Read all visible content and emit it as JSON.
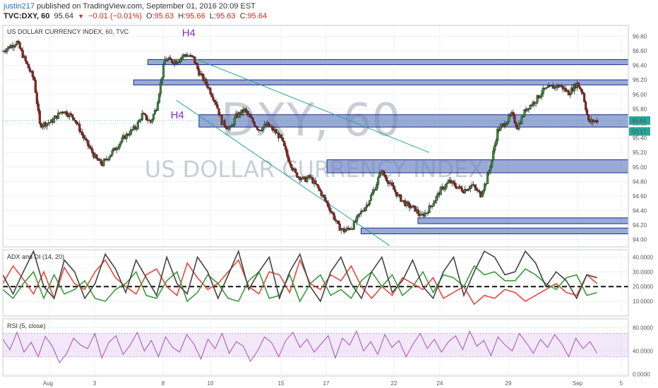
{
  "header": {
    "user": "justin217",
    "published": "published on TradingView.com, September 01, 2016 20:09 EST",
    "symbol": "TVC:DXY, 60",
    "price": "95.64",
    "change": "−0.01 (−0.01%)",
    "o_label": "O:",
    "o_value": "95.63",
    "h_label": "H:",
    "h_value": "95.66",
    "l_label": "L:",
    "l_value": "95.63",
    "c_label": "C:",
    "c_value": "95.64"
  },
  "chart_data": [
    {
      "type": "candlestick",
      "title": "US DOLLAR CURRENCY INDEX, 60, TVC",
      "watermark_symbol": "DXY, 60",
      "watermark_name": "US DOLLAR CURRENCY INDEX",
      "ylim": [
        93.9,
        96.95
      ],
      "y_ticks": [
        94.0,
        94.2,
        94.4,
        94.6,
        94.8,
        95.0,
        95.2,
        95.4,
        95.6,
        95.8,
        96.0,
        96.2,
        96.4,
        96.6,
        96.8
      ],
      "y_tick_labels": [
        "94.00",
        "94.20",
        "94.40",
        "94.60",
        "94.80",
        "95.00",
        "95.20",
        "95.40",
        "95.60",
        "95.80",
        "96.00",
        "96.20",
        "96.40",
        "96.60",
        "96.80"
      ],
      "x_ticks": [
        "Aug",
        "3",
        "8",
        "10",
        "15",
        "17",
        "22",
        "24",
        "29",
        "Sep",
        "5"
      ],
      "price_marker": {
        "value": 95.64,
        "label": "95.64",
        "color": "#26a69a"
      },
      "countdown_marker": {
        "value": 95.49,
        "label": "50:17",
        "color": "#26a69a"
      },
      "price_path": [
        [
          0,
          96.6
        ],
        [
          5,
          96.72
        ],
        [
          8,
          96.45
        ],
        [
          11,
          96.2
        ],
        [
          13,
          95.58
        ],
        [
          17,
          95.62
        ],
        [
          21,
          95.78
        ],
        [
          25,
          95.68
        ],
        [
          29,
          95.36
        ],
        [
          33,
          95.1
        ],
        [
          35,
          95.04
        ],
        [
          39,
          95.23
        ],
        [
          43,
          95.42
        ],
        [
          47,
          95.56
        ],
        [
          49,
          95.72
        ],
        [
          52,
          95.62
        ],
        [
          54,
          95.82
        ],
        [
          57,
          96.48
        ],
        [
          61,
          96.45
        ],
        [
          64,
          96.55
        ],
        [
          67,
          96.5
        ],
        [
          69,
          96.3
        ],
        [
          72,
          96.12
        ],
        [
          75,
          95.88
        ],
        [
          77,
          95.62
        ],
        [
          80,
          95.52
        ],
        [
          82,
          95.7
        ],
        [
          85,
          95.78
        ],
        [
          88,
          95.62
        ],
        [
          90,
          95.52
        ],
        [
          93,
          95.58
        ],
        [
          96,
          95.48
        ],
        [
          98,
          95.38
        ],
        [
          100,
          95.15
        ],
        [
          103,
          94.9
        ],
        [
          106,
          94.82
        ],
        [
          108,
          94.86
        ],
        [
          111,
          94.7
        ],
        [
          114,
          94.5
        ],
        [
          116,
          94.35
        ],
        [
          118,
          94.18
        ],
        [
          120,
          94.12
        ],
        [
          123,
          94.18
        ],
        [
          126,
          94.38
        ],
        [
          128,
          94.48
        ],
        [
          131,
          94.72
        ],
        [
          133,
          94.95
        ],
        [
          136,
          94.78
        ],
        [
          139,
          94.6
        ],
        [
          142,
          94.48
        ],
        [
          145,
          94.42
        ],
        [
          147,
          94.32
        ],
        [
          149,
          94.38
        ],
        [
          152,
          94.55
        ],
        [
          154,
          94.68
        ],
        [
          157,
          94.8
        ],
        [
          160,
          94.72
        ],
        [
          162,
          94.68
        ],
        [
          165,
          94.75
        ],
        [
          168,
          94.62
        ],
        [
          170,
          94.8
        ],
        [
          172,
          95.1
        ],
        [
          174,
          95.5
        ],
        [
          176,
          95.58
        ],
        [
          179,
          95.72
        ],
        [
          181,
          95.55
        ],
        [
          184,
          95.8
        ],
        [
          187,
          95.9
        ],
        [
          190,
          96.05
        ],
        [
          193,
          96.1
        ],
        [
          196,
          96.12
        ],
        [
          199,
          96.02
        ],
        [
          202,
          96.15
        ],
        [
          204,
          96.02
        ],
        [
          206,
          95.62
        ],
        [
          209,
          95.64
        ]
      ],
      "zones": [
        {
          "from_x": 51,
          "to_x": 220,
          "y_low": 96.41,
          "y_high": 96.48
        },
        {
          "from_x": 46,
          "to_x": 220,
          "y_low": 96.13,
          "y_high": 96.2
        },
        {
          "from_x": 69,
          "to_x": 220,
          "y_low": 95.55,
          "y_high": 95.72
        },
        {
          "from_x": 114,
          "to_x": 220,
          "y_low": 94.92,
          "y_high": 95.1
        },
        {
          "from_x": 146,
          "to_x": 220,
          "y_low": 94.22,
          "y_high": 94.3
        },
        {
          "from_x": 126,
          "to_x": 220,
          "y_low": 94.08,
          "y_high": 94.16
        }
      ],
      "trend_channel": [
        {
          "x1": 64,
          "y1": 96.55,
          "x2": 150,
          "y2": 95.2
        },
        {
          "x1": 61,
          "y1": 95.92,
          "x2": 136,
          "y2": 93.92
        }
      ],
      "annotations": [
        {
          "text": "H4",
          "x": 63,
          "y": 96.8
        },
        {
          "text": "H4",
          "x": 59,
          "y": 95.67
        }
      ]
    },
    {
      "type": "line",
      "title": "ADX and DI (14, 20)",
      "ylim": [
        0,
        45
      ],
      "y_tick_labels": [
        "10.0000",
        "20.0000",
        "30.0000",
        "40.0000"
      ],
      "y_ticks": [
        10,
        20,
        30,
        40
      ],
      "threshold": 20,
      "series": [
        {
          "color": "#e8483b",
          "values": [
            22,
            34,
            25,
            15,
            30,
            12,
            33,
            22,
            18,
            30,
            38,
            26,
            20,
            15,
            28,
            32,
            20,
            14,
            36,
            26,
            18,
            22,
            30,
            38,
            20,
            15,
            30,
            28,
            16,
            38,
            22,
            18,
            28,
            24,
            34,
            20,
            12,
            20,
            14,
            26,
            22,
            18,
            26,
            12,
            16,
            20,
            8,
            14,
            12,
            18,
            16,
            10,
            14,
            18,
            22,
            16,
            14,
            28,
            22
          ]
        },
        {
          "color": "#3a9c3a",
          "values": [
            18,
            12,
            22,
            30,
            12,
            28,
            15,
            18,
            24,
            12,
            10,
            18,
            22,
            30,
            14,
            12,
            24,
            30,
            10,
            16,
            28,
            22,
            12,
            10,
            24,
            30,
            12,
            14,
            28,
            10,
            22,
            28,
            14,
            18,
            12,
            24,
            30,
            20,
            28,
            14,
            20,
            30,
            16,
            28,
            26,
            20,
            34,
            28,
            30,
            24,
            24,
            32,
            28,
            22,
            18,
            26,
            28,
            14,
            16
          ]
        },
        {
          "color": "#444444",
          "values": [
            28,
            15,
            30,
            44,
            20,
            12,
            38,
            30,
            12,
            22,
            42,
            32,
            16,
            38,
            26,
            14,
            40,
            22,
            15,
            40,
            30,
            12,
            28,
            44,
            18,
            30,
            40,
            12,
            30,
            42,
            20,
            10,
            30,
            40,
            22,
            12,
            30,
            40,
            16,
            24,
            38,
            20,
            12,
            30,
            40,
            14,
            30,
            44,
            40,
            28,
            30,
            44,
            36,
            20,
            30,
            24,
            12,
            28,
            26
          ]
        }
      ]
    },
    {
      "type": "line",
      "title": "RSI (5, close)",
      "ylim": [
        -3,
        95
      ],
      "y_tick_labels": [
        "0.0000",
        "40.0000",
        "80.0000"
      ],
      "y_ticks": [
        0,
        40,
        80
      ],
      "band": [
        30,
        70
      ],
      "series": [
        {
          "color": "#a54fc1",
          "values": [
            60,
            42,
            72,
            38,
            55,
            30,
            65,
            48,
            20,
            35,
            62,
            50,
            44,
            70,
            28,
            55,
            66,
            34,
            50,
            72,
            40,
            58,
            30,
            64,
            46,
            38,
            68,
            52,
            26,
            60,
            44,
            70,
            36,
            56,
            48,
            22,
            40,
            64,
            54,
            30,
            58,
            72,
            46,
            60,
            38,
            52,
            66,
            28,
            62,
            50,
            74,
            40,
            56,
            34,
            68,
            46,
            58,
            30,
            52,
            70,
            44,
            60,
            38,
            56,
            66,
            42,
            74,
            48,
            58,
            32,
            64,
            50,
            40,
            70,
            54,
            36,
            60,
            46,
            68,
            52,
            30,
            62,
            44,
            56,
            36
          ]
        }
      ]
    }
  ]
}
